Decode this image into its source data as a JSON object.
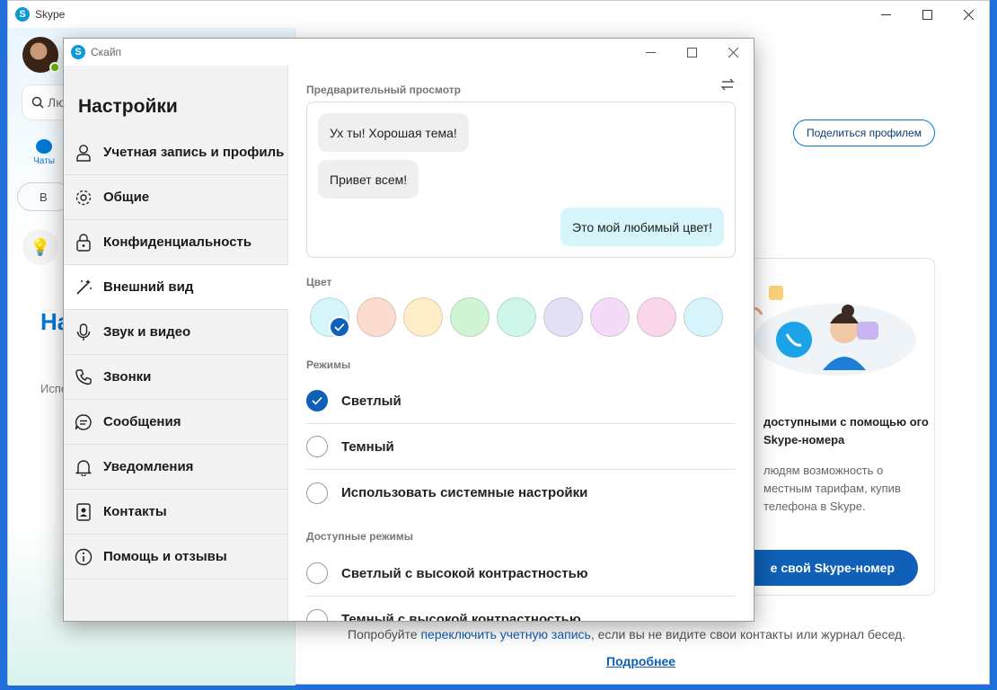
{
  "main_window": {
    "title": "Skype",
    "search_text": "Лю",
    "chats_tab_label": "Чаты",
    "pill_text": "В",
    "heading_fragment": "На",
    "text_fragment": "Испо",
    "share_profile_button": "Поделиться профилем",
    "promo": {
      "title": "доступными с помощью ого Skype-номера",
      "description": "людям возможность о местным тарифам, купив телефона в Skype.",
      "button": "е свой Skype-номер"
    },
    "bottom_note": {
      "before": "Попробуйте ",
      "link": "переключить учетную запись",
      "after": ", если вы не видите свои контакты или журнал бесед."
    },
    "more_link": "Подробнее"
  },
  "dialog": {
    "title": "Скайп",
    "sidebar": {
      "title": "Настройки",
      "items": [
        {
          "label": "Учетная запись и профиль",
          "icon": "person-icon"
        },
        {
          "label": "Общие",
          "icon": "gear-icon"
        },
        {
          "label": "Конфиденциальность",
          "icon": "lock-icon"
        },
        {
          "label": "Внешний вид",
          "icon": "magic-wand-icon",
          "active": true
        },
        {
          "label": "Звук и видео",
          "icon": "microphone-icon"
        },
        {
          "label": "Звонки",
          "icon": "phone-icon"
        },
        {
          "label": "Сообщения",
          "icon": "message-icon"
        },
        {
          "label": "Уведомления",
          "icon": "bell-icon"
        },
        {
          "label": "Контакты",
          "icon": "contacts-book-icon"
        },
        {
          "label": "Помощь и отзывы",
          "icon": "info-icon"
        }
      ]
    },
    "content": {
      "preview_label": "Предварительный просмотр",
      "preview_messages": [
        {
          "text": "Ух ты! Хорошая тема!",
          "mine": false
        },
        {
          "text": "Привет всем!",
          "mine": false
        },
        {
          "text": "Это мой любимый цвет!",
          "mine": true
        }
      ],
      "color_label": "Цвет",
      "colors": [
        "#d5f5fb",
        "#fcdccf",
        "#feeec8",
        "#d0f5d4",
        "#cff6ea",
        "#e2e1f5",
        "#f4dcf8",
        "#f9d6ea",
        "#d7f4fc"
      ],
      "selected_color_index": 0,
      "modes_label": "Режимы",
      "modes": [
        {
          "label": "Светлый",
          "checked": true
        },
        {
          "label": "Темный",
          "checked": false
        },
        {
          "label": "Использовать системные настройки",
          "checked": false
        }
      ],
      "available_modes_label": "Доступные режимы",
      "available_modes": [
        {
          "label": "Светлый с высокой контрастностью",
          "checked": false
        },
        {
          "label": "Темный с высокой контрастностью",
          "checked": false
        }
      ]
    }
  }
}
